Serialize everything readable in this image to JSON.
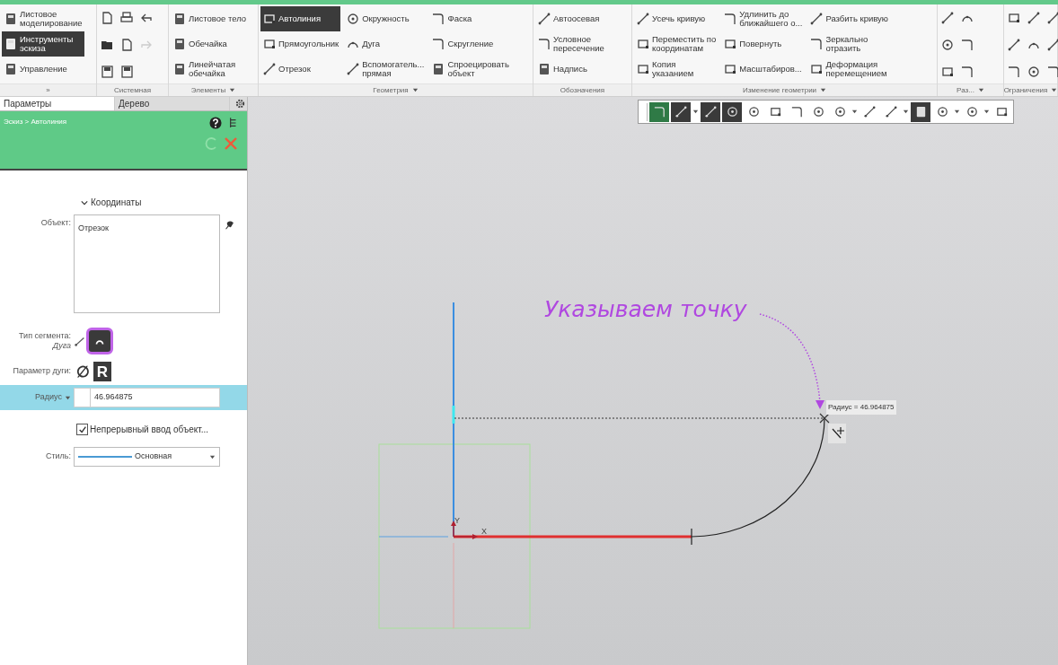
{
  "ribbon": {
    "groups": [
      {
        "kind": "tools",
        "label": "»",
        "has_menu": false,
        "columns": [
          [
            {
              "label": "Листовое\nмоделирование",
              "selected": false
            },
            {
              "label": "Инструменты\nэскиза",
              "selected": true
            },
            {
              "label": "Управление",
              "selected": false
            }
          ]
        ]
      },
      {
        "kind": "icons",
        "label": "Системная",
        "has_menu": false
      },
      {
        "kind": "tools",
        "label": "Элементы",
        "has_menu": true,
        "columns": [
          [
            {
              "label": "Листовое тело",
              "selected": false
            },
            {
              "label": "Обечайка",
              "selected": false
            },
            {
              "label": "Линейчатая\nобечайка",
              "selected": false
            }
          ]
        ]
      },
      {
        "kind": "tools",
        "label": "Геометрия",
        "has_menu": true,
        "columns": [
          [
            {
              "label": "Автолиния",
              "selected": true
            },
            {
              "label": "Прямоугольник",
              "selected": false
            },
            {
              "label": "Отрезок",
              "selected": false
            }
          ],
          [
            {
              "label": "Окружность",
              "selected": false
            },
            {
              "label": "Дуга",
              "selected": false
            },
            {
              "label": "Вспомогатель...\nпрямая",
              "selected": false
            }
          ],
          [
            {
              "label": "Фаска",
              "selected": false
            },
            {
              "label": "Скругление",
              "selected": false
            },
            {
              "label": "Спроецировать\nобъект",
              "selected": false
            }
          ]
        ]
      },
      {
        "kind": "tools",
        "label": "Обозначения",
        "has_menu": false,
        "columns": [
          [
            {
              "label": "Автоосевая",
              "selected": false
            },
            {
              "label": "Условное\nпересечение",
              "selected": false
            },
            {
              "label": "Надпись",
              "selected": false
            }
          ]
        ]
      },
      {
        "kind": "tools",
        "label": "Изменение геометрии",
        "has_menu": true,
        "columns": [
          [
            {
              "label": "Усечь кривую",
              "selected": false
            },
            {
              "label": "Переместить по\nкоординатам",
              "selected": false
            },
            {
              "label": "Копия\nуказанием",
              "selected": false
            }
          ],
          [
            {
              "label": "Удлинить до\nближайшего о...",
              "selected": false
            },
            {
              "label": "Повернуть",
              "selected": false
            },
            {
              "label": "Масштабиров...",
              "selected": false
            }
          ],
          [
            {
              "label": "Разбить кривую",
              "selected": false
            },
            {
              "label": "Зеркально\nотразить",
              "selected": false
            },
            {
              "label": "Деформация\nперемещением",
              "selected": false
            }
          ]
        ]
      },
      {
        "kind": "icons",
        "label": "Раз...",
        "has_menu": true
      },
      {
        "kind": "icons",
        "label": "Ограничения",
        "has_menu": true
      }
    ]
  },
  "panel": {
    "tabs": [
      {
        "label": "Параметры",
        "selected": true
      },
      {
        "label": "Дерево",
        "selected": false
      }
    ],
    "breadcrumb": "Эскиз > Автолиния",
    "section": {
      "label": "Координаты",
      "expanded": true
    },
    "object_label": "Объект:",
    "objects": [
      "Отрезок"
    ],
    "segment_type": {
      "label": "Тип сегмента:",
      "value": "Дуга",
      "options": [
        {
          "kind": "line",
          "selected": false
        },
        {
          "kind": "arc",
          "selected": true
        }
      ]
    },
    "arc_parameter": {
      "label": "Параметр дуги:",
      "options": [
        {
          "label": "∅",
          "selected": false
        },
        {
          "label": "R",
          "selected": true
        }
      ]
    },
    "radius": {
      "label": "Радиус",
      "value": "46.964875"
    },
    "continuous": {
      "label": "Непрерывный ввод объект...",
      "checked": true
    },
    "style": {
      "label": "Стиль:",
      "value": "Основная"
    }
  },
  "view_toolbar": [
    {
      "on": true
    },
    {
      "on": true
    },
    {
      "on": true
    },
    {
      "on": true
    },
    {
      "on": false
    },
    {
      "on": false
    },
    {
      "on": false
    },
    {
      "on": false
    },
    {
      "on": false
    },
    {
      "on": false
    },
    {
      "on": false
    },
    {
      "on": true
    },
    {
      "on": false
    },
    {
      "on": false
    },
    {
      "on": false
    }
  ],
  "canvas": {
    "axis_y": "Y",
    "axis_x": "X",
    "annotation": "Указываем точку",
    "tooltip": "Радиус = 46.964875"
  }
}
